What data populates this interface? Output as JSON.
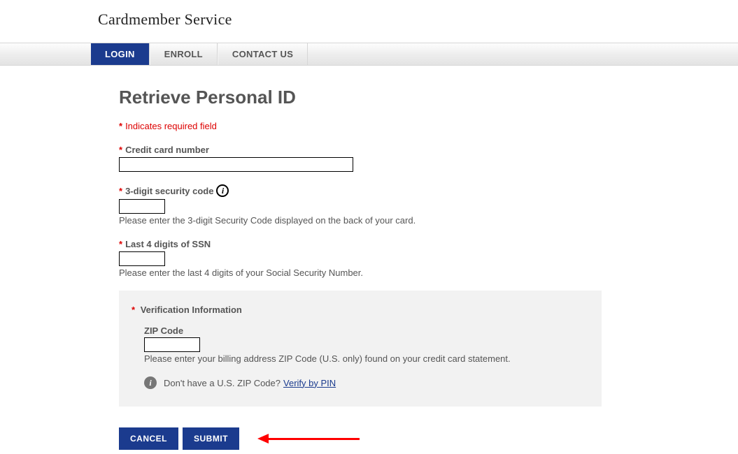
{
  "header": {
    "logo": "Cardmember Service"
  },
  "nav": {
    "login": "LOGIN",
    "enroll": "ENROLL",
    "contact": "CONTACT US"
  },
  "page": {
    "title": "Retrieve Personal ID",
    "required_note": "Indicates required field"
  },
  "fields": {
    "cc": {
      "label": "Credit card number"
    },
    "security": {
      "label": "3-digit security code",
      "hint": "Please enter the 3-digit Security Code displayed on the back of your card."
    },
    "ssn": {
      "label": "Last 4 digits of SSN",
      "hint": "Please enter the last 4 digits of your Social Security Number."
    }
  },
  "verification": {
    "title": "Verification Information",
    "zip_label": "ZIP Code",
    "zip_hint": "Please enter your billing address ZIP Code (U.S. only) found on your credit card statement.",
    "no_zip_text": "Don't have a U.S. ZIP Code?",
    "verify_link": "Verify by PIN"
  },
  "buttons": {
    "cancel": "CANCEL",
    "submit": "SUBMIT"
  }
}
